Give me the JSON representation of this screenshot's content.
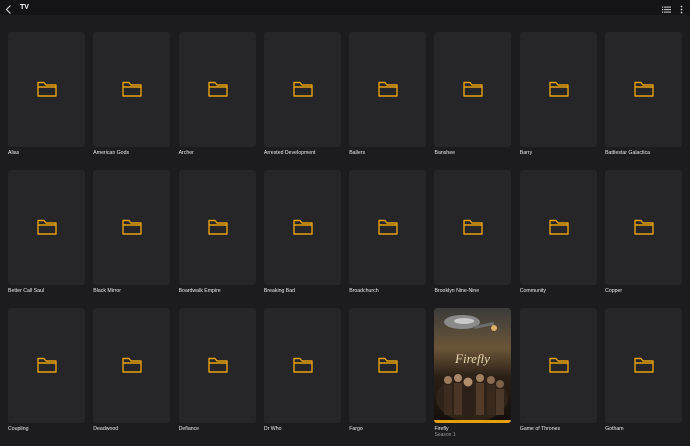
{
  "header": {
    "title": "TV"
  },
  "colors": {
    "accent": "#e5a00d",
    "background": "#1c1c1e",
    "tile": "#262628"
  },
  "icons": {
    "back": "chevron-left-icon",
    "list_view": "list-icon",
    "more": "more-vertical-icon",
    "tile": "folder-icon"
  },
  "items": [
    {
      "label": "Alias"
    },
    {
      "label": "American Gods"
    },
    {
      "label": "Archer"
    },
    {
      "label": "Arrested Development"
    },
    {
      "label": "Ballers"
    },
    {
      "label": "Banshee"
    },
    {
      "label": "Barry"
    },
    {
      "label": "Battlestar Galactica"
    },
    {
      "label": "Better Call Saul"
    },
    {
      "label": "Black Mirror"
    },
    {
      "label": "Boardwalk Empire"
    },
    {
      "label": "Breaking Bad"
    },
    {
      "label": "Broadchurch"
    },
    {
      "label": "Brooklyn Nine-Nine"
    },
    {
      "label": "Community"
    },
    {
      "label": "Copper"
    },
    {
      "label": "Coupling"
    },
    {
      "label": "Deadwood"
    },
    {
      "label": "Defiance"
    },
    {
      "label": "Dr Who"
    },
    {
      "label": "Fargo"
    },
    {
      "label": "Firefly",
      "sublabel": "Season 1",
      "poster_text": "Firefly",
      "progress": 1.0
    },
    {
      "label": "Game of Thrones"
    },
    {
      "label": "Gotham"
    }
  ]
}
